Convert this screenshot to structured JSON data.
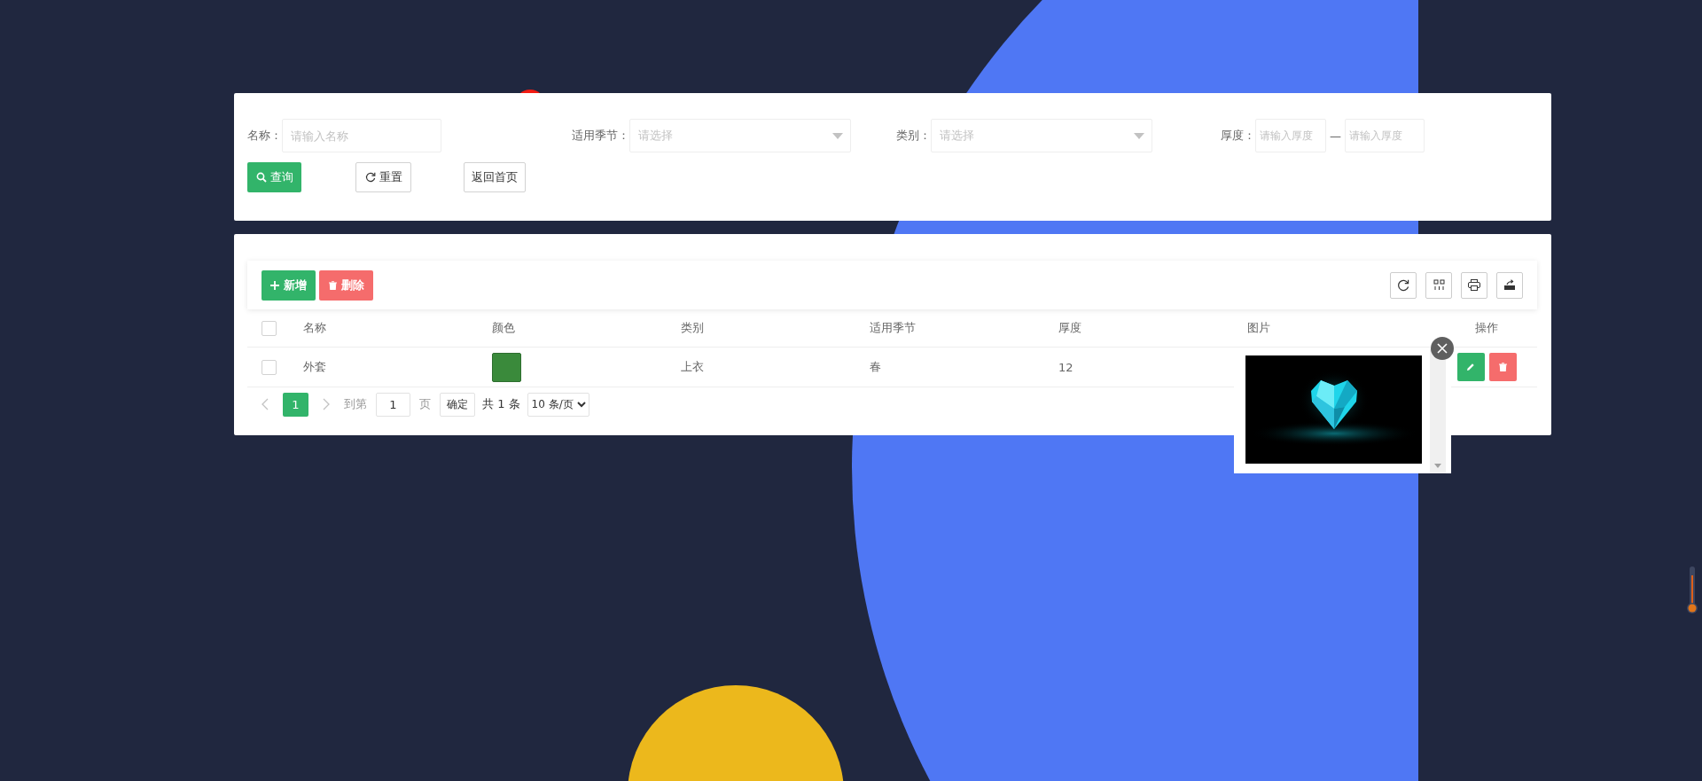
{
  "search_form": {
    "fields": [
      {
        "kind": "text",
        "label": "名称：",
        "placeholder": "请输入名称"
      },
      {
        "kind": "select",
        "label": "适用季节：",
        "placeholder": "请选择"
      },
      {
        "kind": "select",
        "label": "类别：",
        "placeholder": "请选择"
      },
      {
        "kind": "range",
        "label": "厚度：",
        "placeholders": [
          "请输入厚度",
          "请输入厚度"
        ],
        "separator": "—"
      }
    ],
    "buttons": [
      {
        "kind": "search",
        "label": "查询"
      },
      {
        "kind": "reset",
        "label": "重置"
      },
      {
        "kind": "plain",
        "label": "返回首页"
      }
    ]
  },
  "toolbar": {
    "buttons": [
      {
        "kind": "add",
        "label": "新增"
      },
      {
        "kind": "delete",
        "label": "删除"
      }
    ]
  },
  "table": {
    "header_checked": false,
    "columns": [
      "名称",
      "颜色",
      "类别",
      "适用季节",
      "厚度",
      "图片",
      "操作"
    ],
    "rows": [
      {
        "checked": false,
        "name": "外套",
        "color": "#3a8a3b",
        "category": "上衣",
        "season": "春",
        "thickness": "12"
      }
    ]
  },
  "pagination": {
    "current": "1",
    "goto_label": "到第",
    "goto_value": "1",
    "page_label": "页",
    "confirm": "确定",
    "total": "共 1 条",
    "page_size": "10 条/页"
  }
}
